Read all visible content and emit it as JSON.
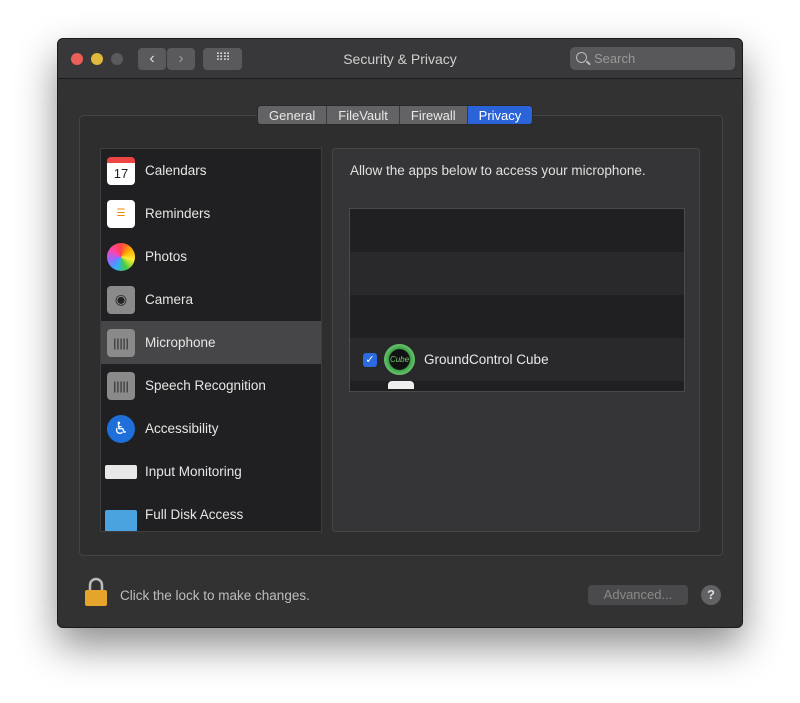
{
  "window": {
    "title": "Security & Privacy",
    "search_placeholder": "Search"
  },
  "tabs": [
    {
      "label": "General"
    },
    {
      "label": "FileVault"
    },
    {
      "label": "Firewall"
    },
    {
      "label": "Privacy"
    }
  ],
  "sidebar": {
    "items": [
      {
        "label": "Calendars",
        "icon": "calendar-icon",
        "badge": "17"
      },
      {
        "label": "Reminders",
        "icon": "reminders-icon"
      },
      {
        "label": "Photos",
        "icon": "photos-icon"
      },
      {
        "label": "Camera",
        "icon": "camera-icon"
      },
      {
        "label": "Microphone",
        "icon": "microphone-icon"
      },
      {
        "label": "Speech Recognition",
        "icon": "speech-recognition-icon"
      },
      {
        "label": "Accessibility",
        "icon": "accessibility-icon"
      },
      {
        "label": "Input Monitoring",
        "icon": "keyboard-icon"
      },
      {
        "label": "Full Disk Access",
        "icon": "folder-icon"
      }
    ],
    "selected": "Microphone"
  },
  "content": {
    "prompt": "Allow the apps below to access your microphone.",
    "apps": [
      {
        "name": "GroundControl Cube",
        "checked": true,
        "icon_text": "Cube"
      }
    ]
  },
  "footer": {
    "lock_text": "Click the lock to make changes.",
    "advanced_label": "Advanced...",
    "help_label": "?"
  },
  "colors": {
    "accent": "#2a64d8"
  }
}
